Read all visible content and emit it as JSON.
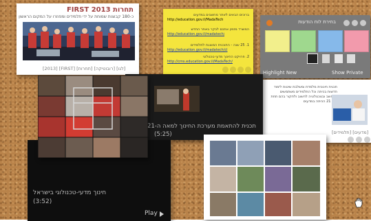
{
  "first_card": {
    "title": "תחרות FIRST 2013",
    "subtitle": "כ-180 קבוצות שמוחת על ידי תלמידים ומפוזרו על המקום הראשון",
    "tags": "[2013] [FIRST] [תחרות] [רובוטיקה] [לגו]"
  },
  "note": {
    "lines": [
      "ברוכים הבאים לאתר מחשבים במדעים",
      "http://education.gov.il/MadaTech",
      "",
      "המשרד מזמין אתכם לבקר באתר החדש",
      "http://education.gov.il/madatech/",
      "",
      "1. 25 שנה - התוכנית המוצגת לתלמידים",
      "http://education.gov.il/madatech/cl",
      "2. פרויקט החינוך מדעי טכנולוגי",
      "http://cms.education.gov.il/MadaTech/"
    ]
  },
  "panel": {
    "title": "בחירת לוח הודעות",
    "swatch_colors": [
      "#f2ef8c",
      "#9fd88e",
      "#86b9ea",
      "#f29aac"
    ],
    "highlight_new": "Highlight New",
    "show_private": "Show Private"
  },
  "article": {
    "paragraph": "תכנית חינוכית מלמדת ומשלבת שיטות לימוד חדשות בכיתה וכל התלמידים משתמשים במחשב ובטכנולוגיה לחשוב ולחקור בהם תחת ל-ה 21 הכיתה במדעים",
    "tags": "[תלמידים] [מדעים]"
  },
  "video_main": {
    "caption": "חינוך מדעי-טכנולוגי בישראל",
    "duration": "(3:52)",
    "play": "Play"
  },
  "video_right": {
    "caption": "תכנית להתאמת מערכת החינוך למאה ה-21",
    "duration": "(5:25)"
  }
}
